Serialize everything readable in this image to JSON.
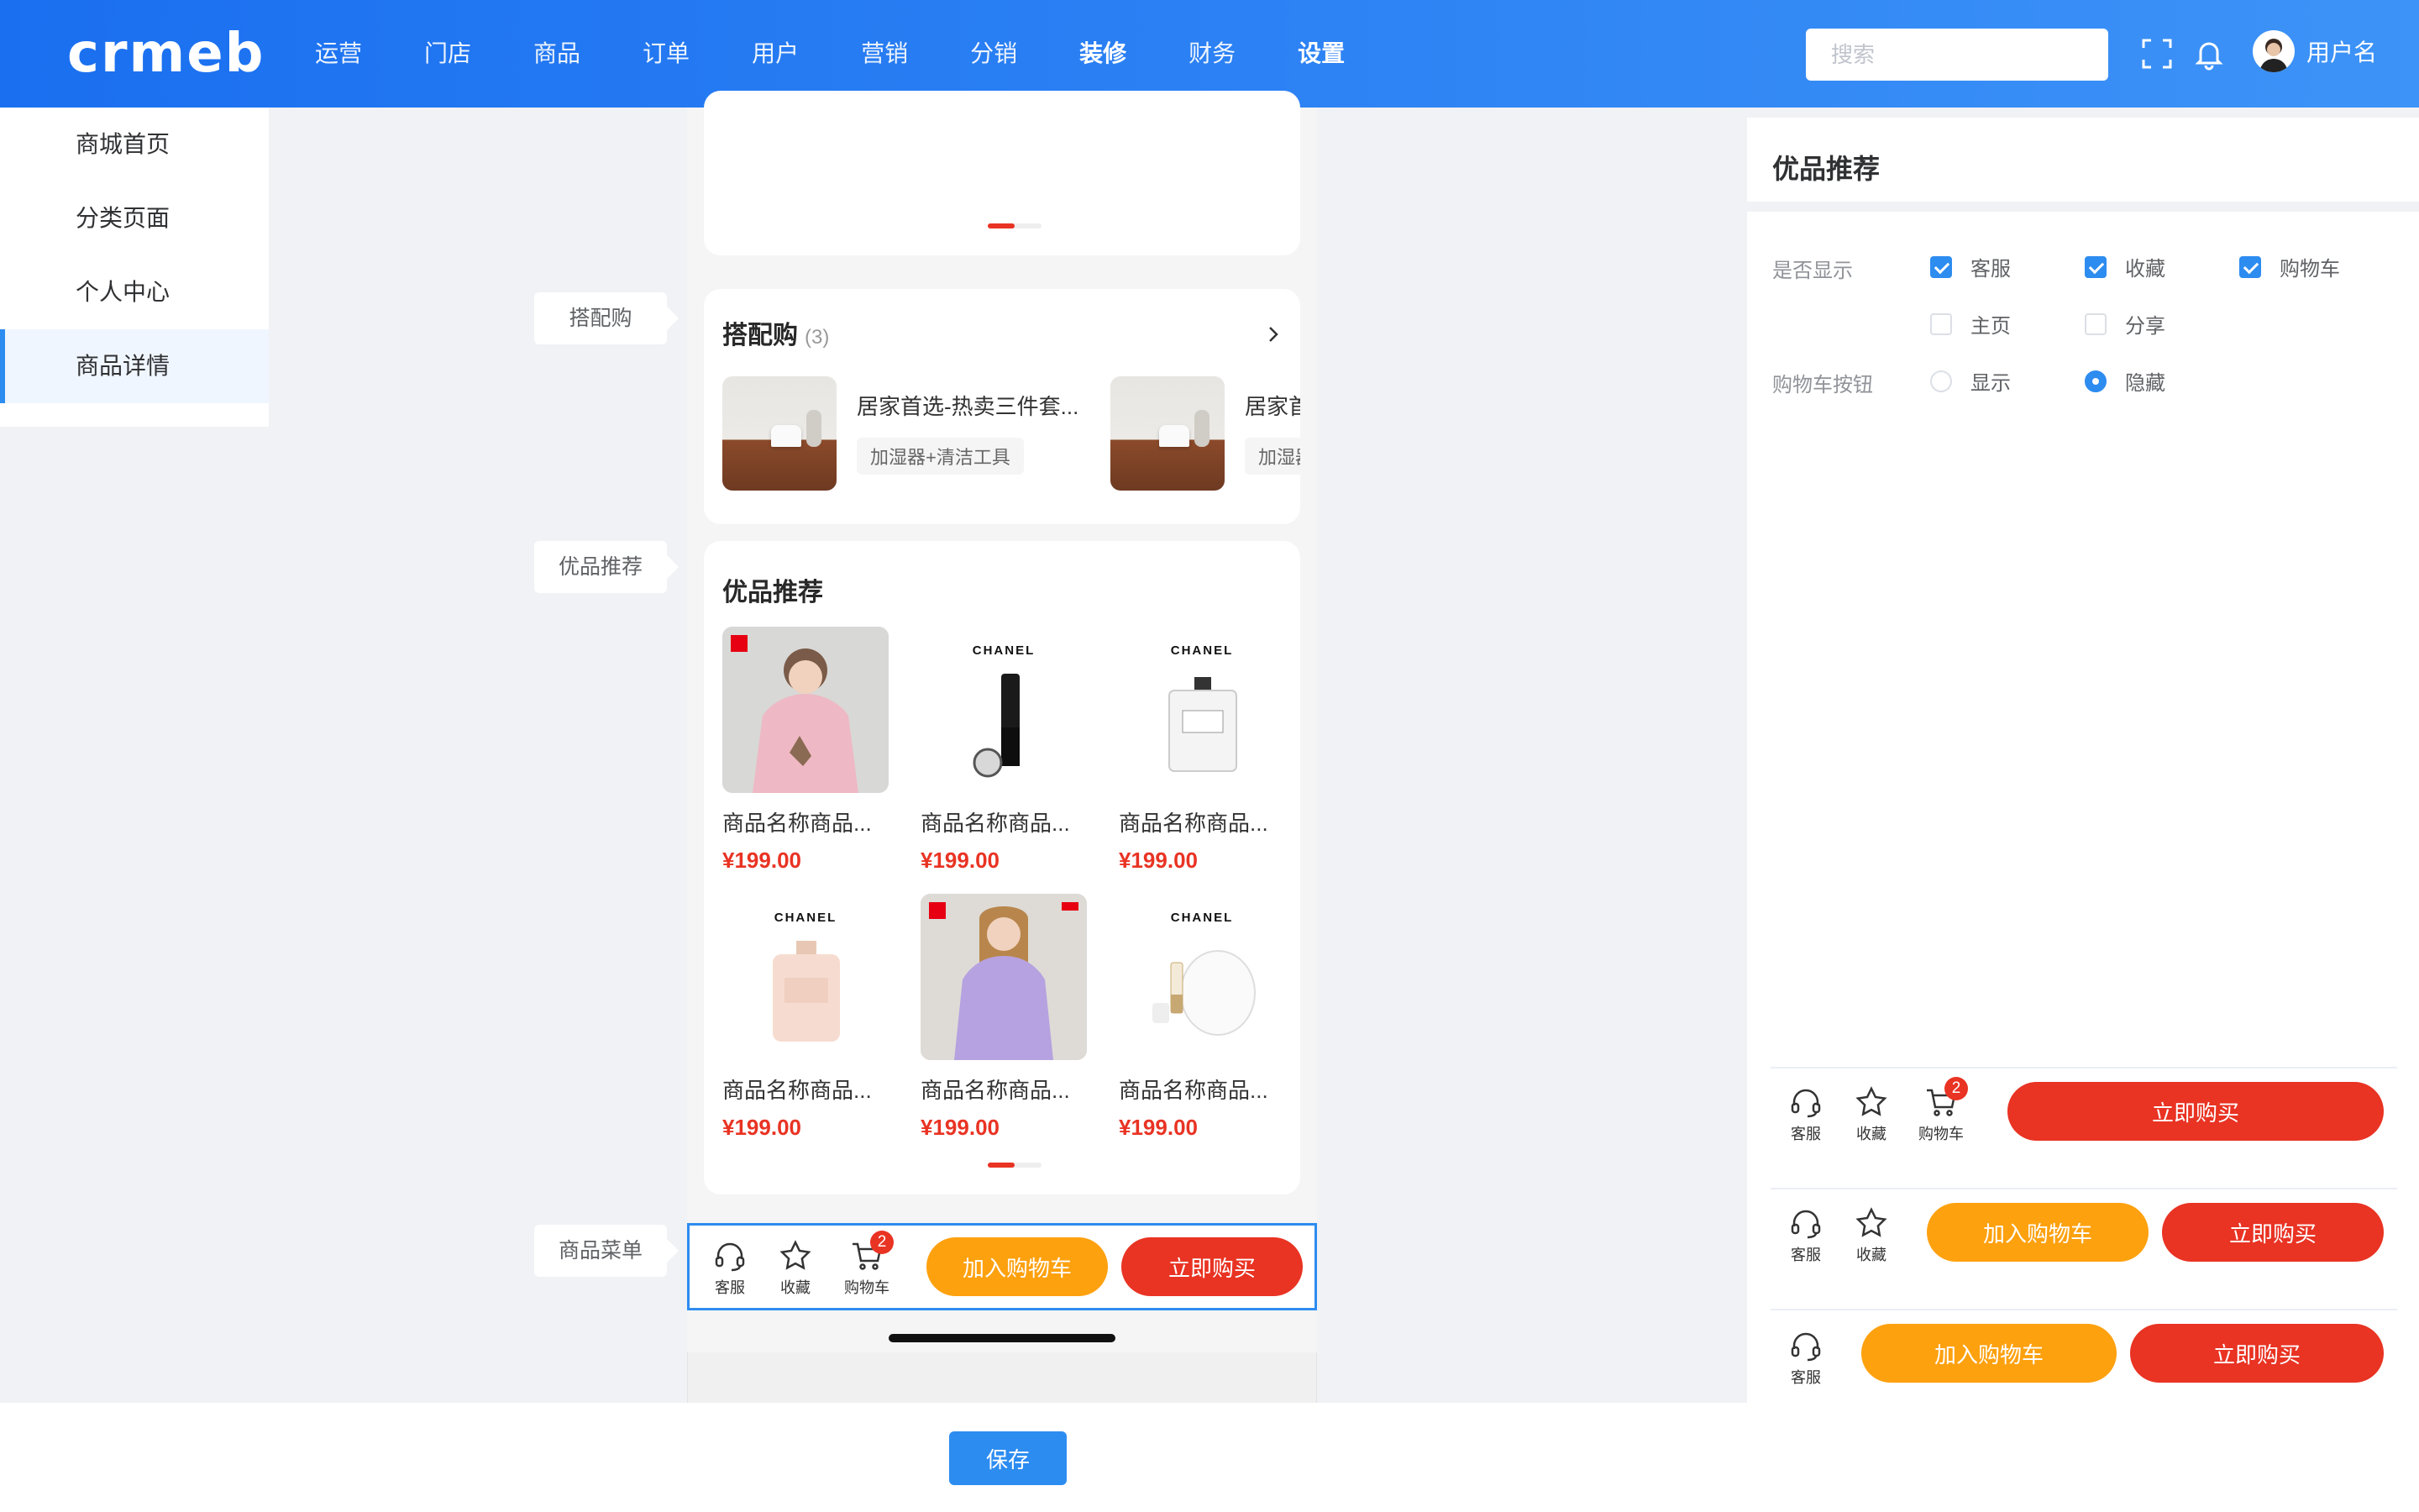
{
  "app": {
    "logo": "crmeb"
  },
  "nav": [
    "运营",
    "门店",
    "商品",
    "订单",
    "用户",
    "营销",
    "分销",
    "装修",
    "财务",
    "设置"
  ],
  "header": {
    "search_placeholder": "搜索",
    "username": "用户名"
  },
  "sidebar": {
    "items": [
      {
        "label": "商城首页"
      },
      {
        "label": "分类页面"
      },
      {
        "label": "个人中心"
      },
      {
        "label": "商品详情"
      }
    ]
  },
  "labels": {
    "combo": "搭配购",
    "recommend": "优品推荐",
    "menu": "商品菜单"
  },
  "combo": {
    "title": "搭配购",
    "count": "(3)",
    "items": [
      {
        "name": "居家首选-热卖三件套...",
        "tag": "加湿器+清洁工具"
      },
      {
        "name": "居家首选-热卖三件套...",
        "tag": "加湿器+清洁工具"
      }
    ]
  },
  "recommend": {
    "title": "优品推荐",
    "products": [
      {
        "name": "商品名称商品...",
        "price": "¥199.00",
        "brand": ""
      },
      {
        "name": "商品名称商品...",
        "price": "¥199.00",
        "brand": "CHANEL"
      },
      {
        "name": "商品名称商品...",
        "price": "¥199.00",
        "brand": "CHANEL"
      },
      {
        "name": "商品名称商品...",
        "price": "¥199.00",
        "brand": "CHANEL"
      },
      {
        "name": "商品名称商品...",
        "price": "¥199.00",
        "brand": ""
      },
      {
        "name": "商品名称商品...",
        "price": "¥199.00",
        "brand": "CHANEL"
      }
    ]
  },
  "action_bar": {
    "service": "客服",
    "favorite": "收藏",
    "cart": "购物车",
    "cart_badge": "2",
    "add_cart": "加入购物车",
    "buy_now": "立即购买"
  },
  "save_label": "保存",
  "panel": {
    "title": "优品推荐",
    "show_label": "是否显示",
    "options": [
      {
        "label": "客服",
        "checked": true
      },
      {
        "label": "收藏",
        "checked": true
      },
      {
        "label": "购物车",
        "checked": true
      },
      {
        "label": "主页",
        "checked": false
      },
      {
        "label": "分享",
        "checked": false
      }
    ],
    "cart_button_label": "购物车按钮",
    "cart_button_options": [
      {
        "label": "显示",
        "selected": false
      },
      {
        "label": "隐藏",
        "selected": true
      }
    ]
  },
  "styles": [
    {
      "service": "客服",
      "favorite": "收藏",
      "cart": "购物车",
      "badge": "2",
      "buy": "立即购买"
    },
    {
      "service": "客服",
      "favorite": "收藏",
      "add_cart": "加入购物车",
      "buy": "立即购买"
    },
    {
      "service": "客服",
      "add_cart": "加入购物车",
      "buy": "立即购买"
    }
  ],
  "colors": {
    "primary": "#2d8cf0",
    "red": "#e93323",
    "orange": "#fea10f"
  }
}
